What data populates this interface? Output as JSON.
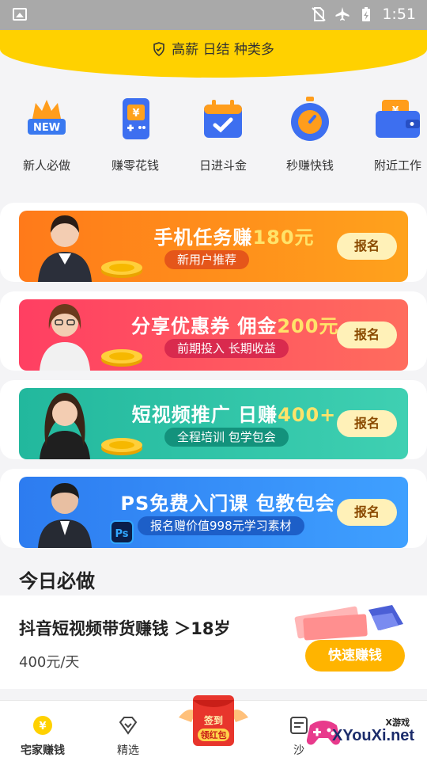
{
  "status": {
    "time": "1:51"
  },
  "top_banner": {
    "text": "高薪 日结 种类多"
  },
  "categories": [
    {
      "label": "新人必做",
      "icon": "crown-new-icon",
      "badge": "NEW"
    },
    {
      "label": "赚零花钱",
      "icon": "phone-yen-icon",
      "badge": "¥"
    },
    {
      "label": "日进斗金",
      "icon": "calendar-check-icon"
    },
    {
      "label": "秒赚快钱",
      "icon": "stopwatch-icon"
    },
    {
      "label": "附近工作",
      "icon": "wallet-icon",
      "badge": "¥"
    }
  ],
  "promos": [
    {
      "title_a": "手机任务赚",
      "title_hl": "180元",
      "subtitle": "新用户推荐",
      "button": "报名",
      "color_from": "#ff7a1a",
      "color_to": "#ffa21c",
      "pill": "#e5561a"
    },
    {
      "title_a": "分享优惠券 佣金",
      "title_hl": "200元",
      "subtitle": "前期投入 长期收益",
      "button": "报名",
      "color_from": "#ff3f62",
      "color_to": "#ff6c5e",
      "pill": "#d92a4e"
    },
    {
      "title_a": "短视频推广 日赚",
      "title_hl": "400+",
      "subtitle": "全程培训 包学包会",
      "button": "报名",
      "color_from": "#22b89d",
      "color_to": "#3fd0b2",
      "pill": "#13927c"
    },
    {
      "title_a": "PS免费入门课 包教包会",
      "title_hl": "",
      "subtitle": "报名赠价值998元学习素材",
      "button": "报名",
      "color_from": "#2d7cf0",
      "color_to": "#3fa0ff",
      "pill": "#1d5fc8"
    }
  ],
  "section": {
    "title": "今日必做"
  },
  "job": {
    "title": "抖音短视频带货赚钱  ＞18岁",
    "price": "400元/天",
    "cta": "快速赚钱"
  },
  "tabs": [
    {
      "label": "宅家赚钱",
      "icon": "yen-coin-icon"
    },
    {
      "label": "精选",
      "icon": "diamond-icon"
    },
    {
      "label": "沙",
      "icon": "list-icon"
    }
  ],
  "redpacket": {
    "line1": "签到",
    "line2": "领红包"
  },
  "watermark": {
    "small": "X游戏",
    "domain": "XYouXi.net"
  }
}
